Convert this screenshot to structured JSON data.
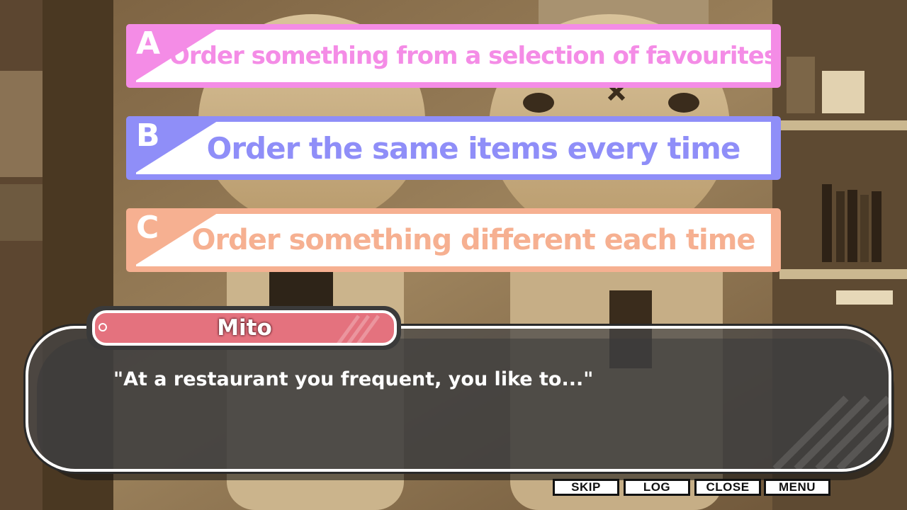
{
  "choices": [
    {
      "letter": "A",
      "text": "Order something from a selection of favourites",
      "color": "#f48ce6"
    },
    {
      "letter": "B",
      "text": "Order the same items every time",
      "color": "#8f8ef8"
    },
    {
      "letter": "C",
      "text": "Order something different each time",
      "color": "#f6b091"
    }
  ],
  "dialog": {
    "speaker": "Mito",
    "line": "\"At a restaurant you frequent, you like to...\"",
    "nameplate_color": "#e4727e"
  },
  "menu": {
    "skip": "SKIP",
    "log": "LOG",
    "close": "CLOSE",
    "menu": "MENU"
  }
}
